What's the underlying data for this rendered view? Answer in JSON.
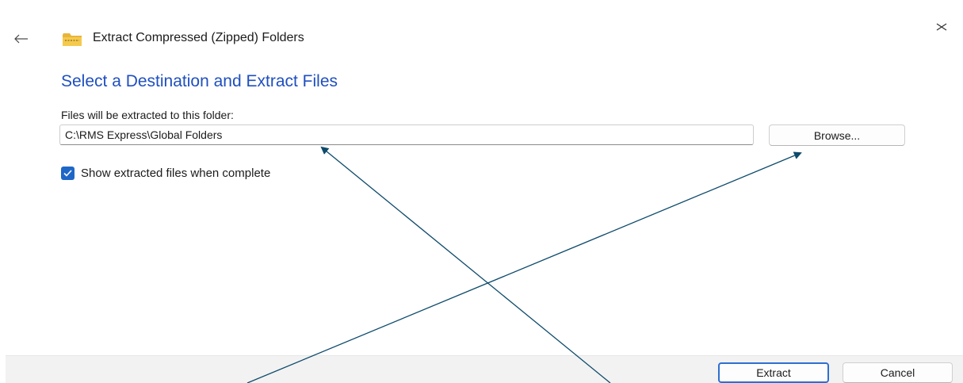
{
  "window": {
    "title": "Extract Compressed (Zipped) Folders",
    "icon": "zipped-folder-icon"
  },
  "header": {
    "back_icon": "back-arrow-icon",
    "close_icon": "close-icon"
  },
  "main": {
    "heading": "Select a Destination and Extract Files",
    "destination_label": "Files will be extracted to this folder:",
    "destination_value": "C:\\RMS Express\\Global Folders",
    "browse_label": "Browse...",
    "show_files_checked": true,
    "show_files_label": "Show extracted files when complete"
  },
  "footer": {
    "extract_label": "Extract",
    "cancel_label": "Cancel"
  },
  "colors": {
    "heading": "#1f4fbf",
    "accent": "#1f67c7",
    "annotation_arrow": "#0d4a6b",
    "footer_bg": "#f2f2f2"
  }
}
